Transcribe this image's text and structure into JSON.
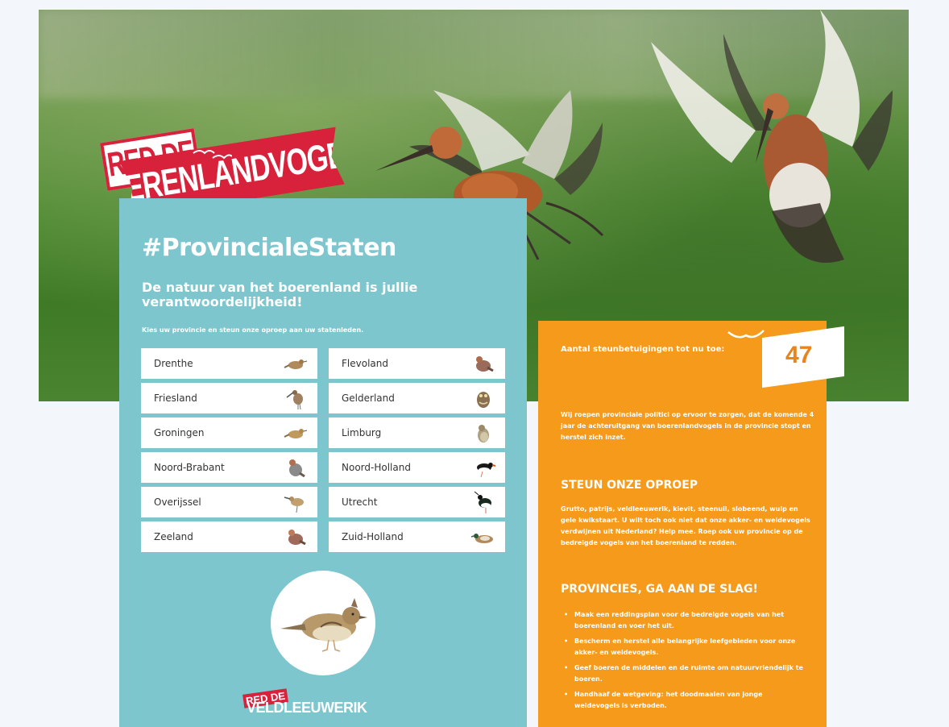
{
  "logo": {
    "line1": "RED DE",
    "line2": "BOERENLANDVOGELS"
  },
  "hashtag": "#ProvincialeStaten",
  "subtitle": "De natuur van het boerenland is jullie verantwoordelijkheid!",
  "instruction": "Kies uw provincie en steun onze oproep aan uw statenleden.",
  "provinces": [
    {
      "label": "Drenthe",
      "icon": "songbird-icon"
    },
    {
      "label": "Flevoland",
      "icon": "partridge-icon"
    },
    {
      "label": "Friesland",
      "icon": "curlew-icon"
    },
    {
      "label": "Gelderland",
      "icon": "owl-icon"
    },
    {
      "label": "Groningen",
      "icon": "songbird-icon"
    },
    {
      "label": "Limburg",
      "icon": "bird-icon"
    },
    {
      "label": "Noord-Brabant",
      "icon": "partridge-icon"
    },
    {
      "label": "Noord-Holland",
      "icon": "oystercatcher-icon"
    },
    {
      "label": "Overijssel",
      "icon": "curlew-icon"
    },
    {
      "label": "Utrecht",
      "icon": "lapwing-icon"
    },
    {
      "label": "Zeeland",
      "icon": "partridge-icon"
    },
    {
      "label": "Zuid-Holland",
      "icon": "duck-icon"
    }
  ],
  "campaign_logo": {
    "line1": "RED DE",
    "line2": "VELDLEEUWERIK"
  },
  "counter": {
    "label": "Aantal steunbetuigingen tot nu toe:",
    "value": "47"
  },
  "intro": "Wij roepen provinciale politici op ervoor te zorgen, dat de komende 4 jaar de achteruitgang van boerenlandvogels in de provincie stopt en herstel zich inzet.",
  "section1": {
    "heading": "STEUN ONZE OPROEP",
    "body": "Grutto, patrijs, veldleeuwerik, kievit, steenuil, slobeend, wulp en gele kwikstaart. U wilt toch ook niet dat onze akker- en weidevogels verdwijnen uit Nederland? Help mee. Roep ook uw provincie op de bedreigde vogels van het boerenland te redden."
  },
  "section2": {
    "heading": "PROVINCIES, GA AAN DE SLAG!",
    "bullets": [
      "Maak een reddingsplan voor de bedreigde vogels van het boerenland en voer het uit.",
      "Bescherm en herstel alle belangrijke leefgebieden voor onze akker- en weidevogels.",
      "Geef boeren de middelen en de ruimte om natuurvriendelijk te boeren.",
      "Handhaaf de wetgeving: het doodmaaien van jonge weidevogels is verboden."
    ]
  },
  "colors": {
    "teal": "#7ec6ce",
    "orange": "#f59a1a",
    "red": "#d8213b"
  }
}
